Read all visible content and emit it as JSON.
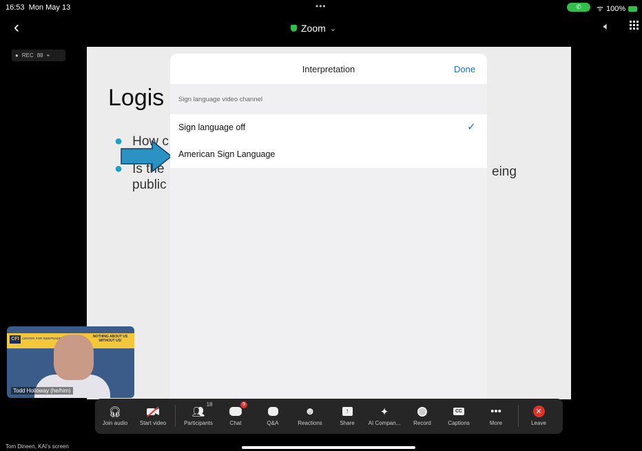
{
  "status_bar": {
    "time": "16:53",
    "date": "Mon May 13",
    "battery": "100%"
  },
  "nav": {
    "title": "Zoom",
    "title_chevron": "⌄"
  },
  "slide": {
    "title": "Logis",
    "bullet1": "How c",
    "bullet2": "Is the",
    "bullet2_cont": "public",
    "right_fragment": "eing"
  },
  "modal": {
    "title": "Interpretation",
    "done_label": "Done",
    "section_label": "Sign language video channel",
    "options": [
      {
        "label": "Sign language off",
        "selected": true
      },
      {
        "label": "American Sign Language",
        "selected": false
      }
    ]
  },
  "video_tile": {
    "name": "Todd Holloway (he/him)",
    "banner_logo": "CFI",
    "banner_text": "CENTER FOR INDEPENDENCE",
    "banner_slogan": "NOTHING ABOUT US WITHOUT US!"
  },
  "toolbar": {
    "items": [
      {
        "key": "join_audio",
        "label": "Join audio",
        "icon": "headphones-icon"
      },
      {
        "key": "start_video",
        "label": "Start video",
        "icon": "video-off-icon"
      },
      {
        "key": "participants",
        "label": "Participants",
        "icon": "participants-icon",
        "count": "18"
      },
      {
        "key": "chat",
        "label": "Chat",
        "icon": "chat-icon",
        "badge": "9"
      },
      {
        "key": "qa",
        "label": "Q&A",
        "icon": "qa-icon"
      },
      {
        "key": "reactions",
        "label": "Reactions",
        "icon": "reactions-icon"
      },
      {
        "key": "share",
        "label": "Share",
        "icon": "share-icon"
      },
      {
        "key": "ai_companion",
        "label": "AI Compan...",
        "icon": "sparkle-icon"
      },
      {
        "key": "record",
        "label": "Record",
        "icon": "record-icon"
      },
      {
        "key": "captions",
        "label": "Captions",
        "icon": "captions-icon",
        "glyph": "CC"
      },
      {
        "key": "more",
        "label": "More",
        "icon": "more-icon"
      },
      {
        "key": "leave",
        "label": "Leave",
        "icon": "leave-icon"
      }
    ]
  },
  "screen_owner": "Tom Dineen, KAI's screen",
  "colors": {
    "accent_blue": "#1a6ee6",
    "leave_red": "#e0322d",
    "call_green": "#2fbf4a",
    "arrow_blue": "#2b93c4"
  }
}
